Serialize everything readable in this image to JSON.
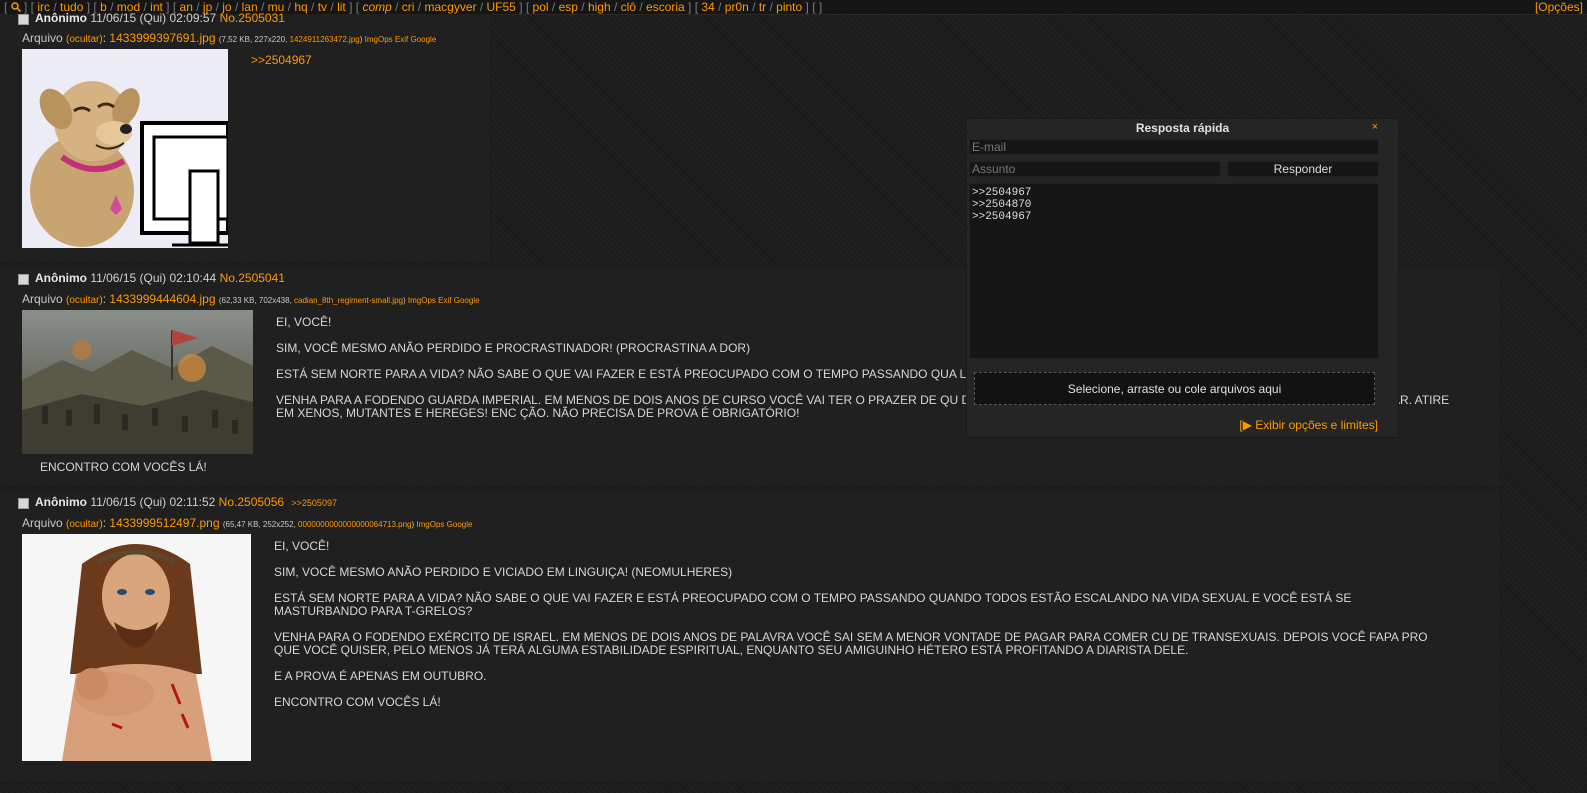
{
  "topbar": {
    "search_icon": "search-icon",
    "groups": [
      [
        "irc",
        "tudo"
      ],
      [
        "b",
        "mod",
        "int"
      ],
      [
        "an",
        "jp",
        "jo",
        "lan",
        "mu",
        "hq",
        "tv",
        "lit"
      ],
      [
        "comp",
        "cri",
        "macgyver",
        "UF55"
      ],
      [
        "pol",
        "esp",
        "high",
        "clô",
        "escoria"
      ],
      [
        "34",
        "pr0n",
        "tr",
        "pinto"
      ]
    ],
    "options_label": "[Opções]"
  },
  "posts": [
    {
      "name": "Anônimo",
      "date": "11/06/15 (Qui) 02:09:57",
      "number": "No.2505031",
      "file_label": "Arquivo",
      "hide_label": "(ocultar)",
      "filename": "1433999397691.jpg",
      "fileinfo": "(7,52 KB, 227x220,",
      "original_name": "1424911263472.jpg",
      "tools": [
        "ImgOps",
        "Exif",
        "Google"
      ],
      "body": [
        ">>2504967"
      ],
      "caption": ""
    },
    {
      "name": "Anônimo",
      "date": "11/06/15 (Qui) 02:10:44",
      "number": "No.2505041",
      "file_label": "Arquivo",
      "hide_label": "(ocultar)",
      "filename": "1433999444604.jpg",
      "fileinfo": "(62,33 KB, 702x438,",
      "original_name": "cadian_8th_regiment-small.jpg",
      "tools": [
        "ImgOps",
        "Exif",
        "Google"
      ],
      "body": [
        "EI, VOCÊ!",
        "SIM, VOCÊ MESMO ANÃO PERDIDO E PROCRASTINADOR! (PROCRASTINA A DOR)",
        "ESTÁ SEM NORTE PARA A VIDA? NÃO SABE O QUE VAI FAZER E ESTÁ PREOCUPADO COM O TEMPO PASSANDO QUA LURKANDO NO CHAN?",
        "VENHA PARA A FODENDO GUARDA IMPERIAL. EM MENOS DE DOIS ANOS DE CURSO VOCÊ VAI TER O PRAZER DE QU DEPOIS VOCÊ CONTINUARA LUTANDO AONDE O ALTO COMANDO TE ENFIAR. ATIRE EM XENOS, MUTANTES E HEREGES! ENC ÇÃO. NÃO PRECISA DE PROVA É OBRIGATÓRIO!"
      ],
      "caption": "ENCONTRO COM VOCÊS LÁ!"
    },
    {
      "name": "Anônimo",
      "date": "11/06/15 (Qui) 02:11:52",
      "number": "No.2505056",
      "reply_link": ">>2505097",
      "file_label": "Arquivo",
      "hide_label": "(ocultar)",
      "filename": "1433999512497.png",
      "fileinfo": "(65,47 KB, 252x252,",
      "original_name": "0000000000000000064713.png",
      "tools": [
        "ImgOps",
        "Google"
      ],
      "body": [
        "EI, VOCÊ!",
        "SIM, VOCÊ MESMO ANÃO PERDIDO E VICIADO EM LINGUIÇA! (NEOMULHERES)",
        "ESTÁ SEM NORTE PARA A VIDA? NÃO SABE O QUE VAI FAZER E ESTÁ PREOCUPADO COM O TEMPO PASSANDO QUANDO TODOS ESTÃO ESCALANDO NA VIDA SEXUAL E VOCÊ ESTÁ SE MASTURBANDO PARA T-GRELOS?",
        "VENHA PARA O FODENDO EXÉRCITO DE ISRAEL. EM MENOS DE DOIS ANOS DE PALAVRA VOCÊ SAI SEM A MENOR VONTADE DE PAGAR PARA COMER CU DE TRANSEXUAIS. DEPOIS VOCÊ FAPA PRO QUE VOCÊ QUISER, PELO MENOS JÁ TERÁ ALGUMA ESTABILIDADE ESPIRITUAL, ENQUANTO SEU AMIGUINHO HÉTERO ESTÁ PROFITANDO A DIARISTA DELE.",
        "E A PROVA É APENAS EM OUTUBRO.",
        "ENCONTRO COM VOCÊS LÁ!"
      ],
      "caption": ""
    }
  ],
  "quick_reply": {
    "title": "Resposta rápida",
    "close": "×",
    "email_placeholder": "E-mail",
    "subject_placeholder": "Assunto",
    "submit_label": "Responder",
    "comment": ">>2504967\n>>2504870\n>>2504967",
    "drop_label": "Selecione, arraste ou cole arquivos aqui",
    "options_label": "[▶ Exibir opções e limites]"
  }
}
